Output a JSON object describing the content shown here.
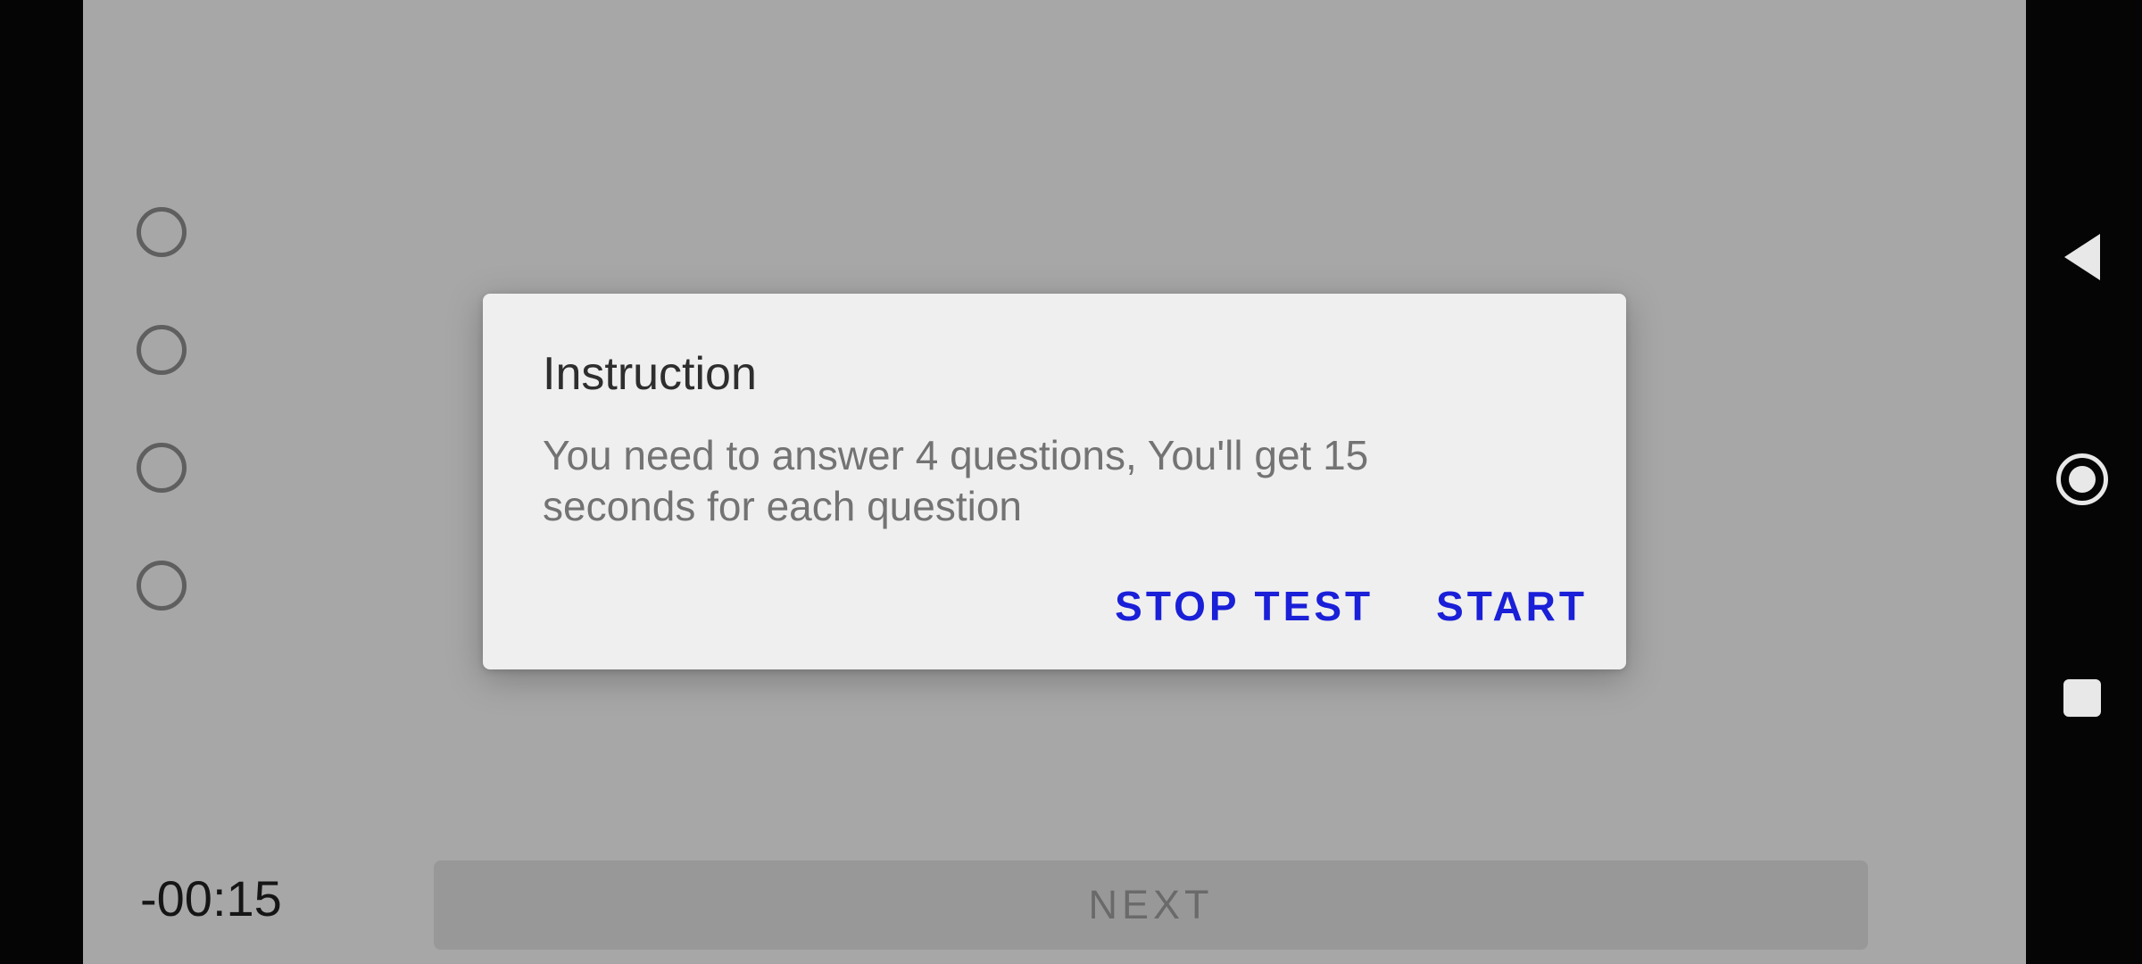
{
  "quiz": {
    "options_count": 4,
    "timer": "-00:15",
    "next_label": "NEXT"
  },
  "dialog": {
    "title": "Instruction",
    "message": "You need to answer 4 questions, You'll get 15 seconds for each question",
    "stop_label": "STOP TEST",
    "start_label": "START"
  },
  "navbar": {
    "icons": [
      "back-icon",
      "home-icon",
      "recents-icon"
    ]
  },
  "colors": {
    "accent": "#1a1fd8",
    "scrim_background": "#a7a7a7",
    "dialog_background": "#efefef"
  }
}
